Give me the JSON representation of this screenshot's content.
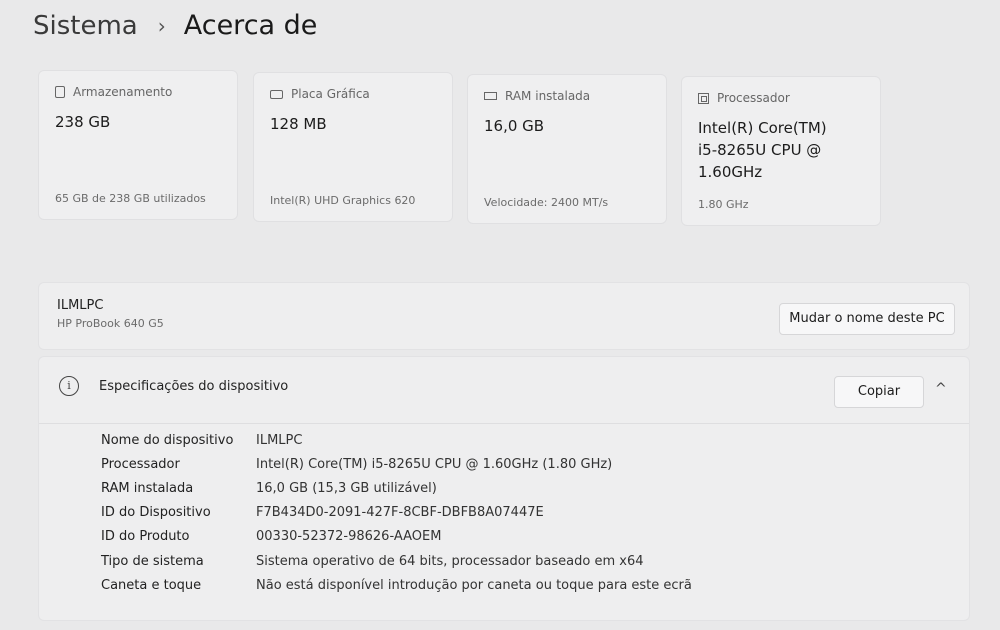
{
  "breadcrumb": {
    "parent": "Sistema",
    "separator": "›",
    "current": "Acerca de"
  },
  "cards": [
    {
      "icon": "storage-icon",
      "label": "Armazenamento",
      "value": "238 GB",
      "foot": "65 GB de 238 GB utilizados"
    },
    {
      "icon": "graphics-card-icon",
      "label": "Placa Gráfica",
      "value": "128 MB",
      "foot": "Intel(R) UHD Graphics 620"
    },
    {
      "icon": "ram-icon",
      "label": "RAM instalada",
      "value": "16,0 GB",
      "foot": "Velocidade: 2400 MT/s"
    },
    {
      "icon": "processor-icon",
      "label": "Processador",
      "value_lines": [
        "Intel(R) Core(TM)",
        "i5-8265U CPU @",
        "1.60GHz"
      ],
      "foot": "1.80 GHz"
    }
  ],
  "device": {
    "name": "ILMLPC",
    "model": "HP ProBook 640 G5",
    "rename_label": "Mudar o nome deste PC"
  },
  "specs": {
    "title": "Especificações do dispositivo",
    "copy_label": "Copiar",
    "rows": [
      {
        "key": "Nome do dispositivo",
        "value": "ILMLPC"
      },
      {
        "key": "Processador",
        "value": "Intel(R) Core(TM) i5-8265U CPU @ 1.60GHz (1.80 GHz)"
      },
      {
        "key": "RAM instalada",
        "value": "16,0 GB (15,3 GB utilizável)"
      },
      {
        "key": "ID do Dispositivo",
        "value": "F7B434D0-2091-427F-8CBF-DBFB8A07447E"
      },
      {
        "key": "ID do Produto",
        "value": "00330-52372-98626-AAOEM"
      },
      {
        "key": "Tipo de sistema",
        "value": "Sistema operativo de 64 bits, processador baseado em x64"
      },
      {
        "key": "Caneta e toque",
        "value": "Não está disponível introdução por caneta ou toque para este ecrã"
      }
    ]
  }
}
